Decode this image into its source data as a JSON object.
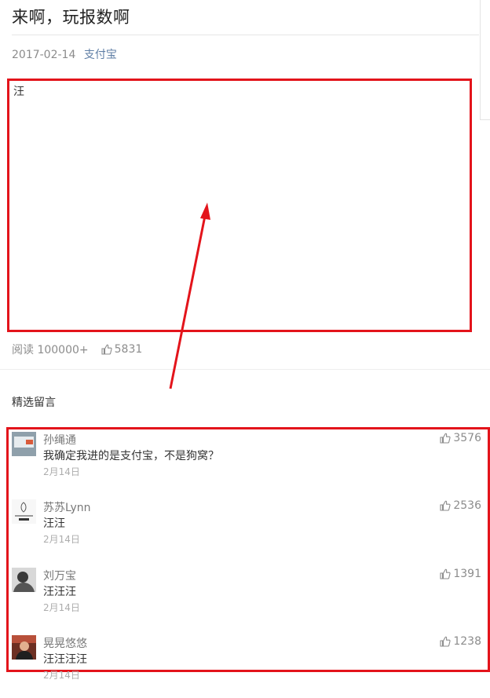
{
  "article": {
    "title": "来啊，玩报数啊",
    "date": "2017-02-14",
    "source": "支付宝",
    "content_text": "汪"
  },
  "stats": {
    "read_label": "阅读 100000+",
    "like_count": "5831"
  },
  "comments_section": {
    "title": "精选留言",
    "items": [
      {
        "name": "孙绳通",
        "text": "我确定我进的是支付宝，不是狗窝？",
        "date": "2月14日",
        "likes": "3576",
        "avatar_color": "#8a9aa6"
      },
      {
        "name": "苏苏Lynn",
        "text": "汪汪",
        "date": "2月14日",
        "likes": "2536",
        "avatar_color": "#f4f4f4"
      },
      {
        "name": "刘万宝",
        "text": "汪汪汪",
        "date": "2月14日",
        "likes": "1391",
        "avatar_color": "#5a5a5a"
      },
      {
        "name": "晃晃悠悠",
        "text": "汪汪汪汪",
        "date": "2月14日",
        "likes": "1238",
        "avatar_color": "#7a3a2a"
      }
    ]
  },
  "colors": {
    "annotation_red": "#e3141b",
    "link_blue": "#607fa6"
  },
  "icons": {
    "like": "thumbs-up-icon",
    "arrow": "red-annotation-arrow"
  }
}
